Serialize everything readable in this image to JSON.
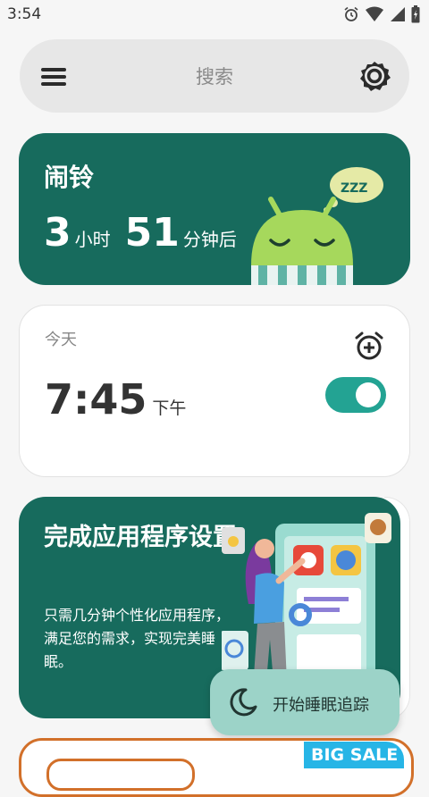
{
  "status_bar": {
    "time": "3:54",
    "icons": [
      "alarm-clock-icon",
      "wifi-icon",
      "signal-icon",
      "battery-icon"
    ]
  },
  "search": {
    "label": "搜索",
    "icons": [
      "menu-icon",
      "gear-icon"
    ]
  },
  "alarm_card": {
    "title": "闹铃",
    "hours": "3",
    "hours_unit": "小时",
    "minutes": "51",
    "minutes_unit": "分钟后",
    "mascot_text": "ZZZ",
    "color": "#176b5d"
  },
  "today_card": {
    "label": "今天",
    "time": "7:45",
    "ampm": "下午",
    "enabled": true,
    "toggle_color": "#23a393"
  },
  "setup_card": {
    "title": "完成应用程序设置",
    "description": "只需几分钟个性化应用程序，满足您的需求，实现完美睡眠。"
  },
  "fab": {
    "label": "开始睡眠追踪",
    "icon": "moon-icon",
    "color": "#9cd3c8"
  },
  "promo": {
    "badge": "BIG SALE"
  }
}
